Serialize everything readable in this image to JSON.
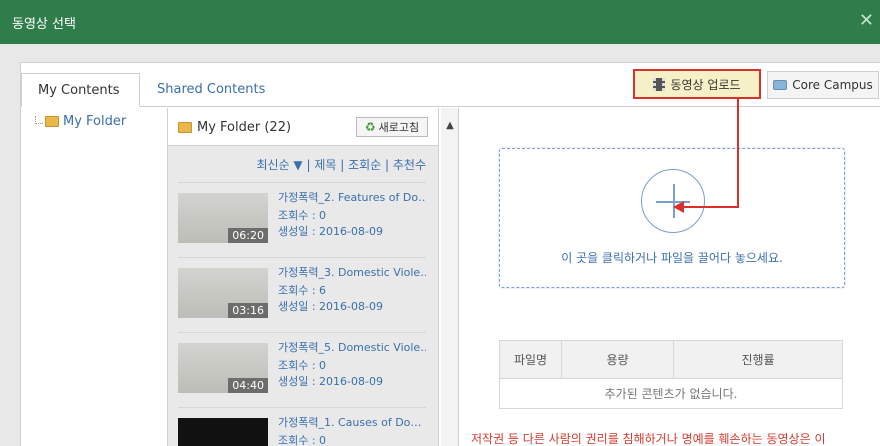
{
  "dialog": {
    "title": "동영상 선택",
    "close_glyph": "✕"
  },
  "tabs": [
    {
      "label": "My Contents"
    },
    {
      "label": "Shared Contents"
    }
  ],
  "toolbar": {
    "upload_label": "동영상 업로드",
    "core_campus_label": "Core Campus"
  },
  "tree": {
    "root_label": "My Folder"
  },
  "list": {
    "folder_title": "My Folder (22)",
    "refresh_label": "새로고침",
    "sort_options": "최신순 ▼ | 제목 | 조회순 | 추천수",
    "items": [
      {
        "title": "가정폭력_2. Features of Do…",
        "views": "조회수 : 0",
        "created": "생성일 : 2016-08-09",
        "duration": "06:20"
      },
      {
        "title": "가정폭력_3. Domestic Viole…",
        "views": "조회수 : 6",
        "created": "생성일 : 2016-08-09",
        "duration": "03:16"
      },
      {
        "title": "가정폭력_5. Domestic Viole…",
        "views": "조회수 : 0",
        "created": "생성일 : 2016-08-09",
        "duration": "04:40"
      },
      {
        "title": "가정폭력_1. Causes of Do…",
        "views": "조회수 : 0",
        "created": "",
        "duration": ""
      }
    ]
  },
  "dropzone": {
    "text": "이 곳을 클릭하거나 파일을 끌어다 놓으세요."
  },
  "filetable": {
    "headers": [
      "파일명",
      "용량",
      "진행률"
    ],
    "empty_text": "추가된 콘텐츠가 없습니다."
  },
  "warning": {
    "text": "저작권 등 다른 사람의 권리를 침해하거나 명예를 훼손하는 동영상은 이"
  },
  "colors": {
    "header_green": "#2e7d4a",
    "highlight_red": "#d9302a",
    "link_blue": "#3a6fae"
  }
}
